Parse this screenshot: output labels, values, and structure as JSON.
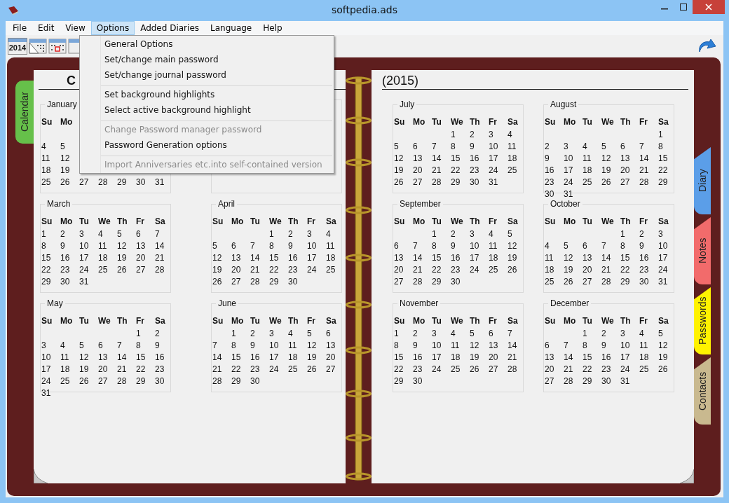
{
  "window": {
    "title": "softpedia.ads"
  },
  "menu": [
    {
      "label": "File",
      "selected": false
    },
    {
      "label": "Edit",
      "selected": false
    },
    {
      "label": "View",
      "selected": false
    },
    {
      "label": "Options",
      "selected": true
    },
    {
      "label": "Added Diaries",
      "selected": false
    },
    {
      "label": "Language",
      "selected": false
    },
    {
      "label": "Help",
      "selected": false
    }
  ],
  "dropdown": {
    "groups": [
      [
        {
          "label": "General Options",
          "disabled": false
        },
        {
          "label": "Set/change main password",
          "disabled": false
        },
        {
          "label": "Set/change journal password",
          "disabled": false
        }
      ],
      [
        {
          "label": "Set background highlights",
          "disabled": false
        },
        {
          "label": "Select active background highlight",
          "disabled": false
        }
      ],
      [
        {
          "label": "Change Password manager password",
          "disabled": true
        },
        {
          "label": "Password Generation options",
          "disabled": false
        }
      ],
      [
        {
          "label": "Import Anniversaries etc.into self-contained version",
          "disabled": true
        }
      ]
    ]
  },
  "toolbar": {
    "year_button": "2014"
  },
  "tabs": [
    {
      "label": "Calendar",
      "selected": true,
      "color": "#66c04a"
    },
    {
      "label": "Diary",
      "selected": false,
      "color": "#5b9ee8"
    },
    {
      "label": "Notes",
      "selected": false,
      "color": "#f26b6b"
    },
    {
      "label": "Passwords",
      "selected": false,
      "color": "#fff200"
    },
    {
      "label": "Contacts",
      "selected": false,
      "color": "#c9b98f"
    }
  ],
  "pages": [
    {
      "heading": "C",
      "months": [
        {
          "kind": "month_first_row_covered",
          "name": "January",
          "day_headers": [
            "Su",
            "Mo"
          ],
          "weeks": [
            [
              "4",
              "5"
            ],
            [
              "11",
              "12"
            ],
            [
              "18",
              "19"
            ],
            [
              "25",
              "26",
              "27",
              "28",
              "29",
              "30",
              "31"
            ]
          ]
        },
        {
          "kind": "covered_frame"
        },
        {
          "kind": "month",
          "name": "March",
          "day_headers": [
            "Su",
            "Mo",
            "Tu",
            "We",
            "Th",
            "Fr",
            "Sa"
          ],
          "weeks": [
            [
              "1",
              "2",
              "3",
              "4",
              "5",
              "6",
              "7"
            ],
            [
              "8",
              "9",
              "10",
              "11",
              "12",
              "13",
              "14"
            ],
            [
              "15",
              "16",
              "17",
              "18",
              "19",
              "20",
              "21"
            ],
            [
              "22",
              "23",
              "24",
              "25",
              "26",
              "27",
              "28"
            ],
            [
              "29",
              "30",
              "31"
            ]
          ]
        },
        {
          "kind": "month",
          "name": "April",
          "day_headers": [
            "Su",
            "Mo",
            "Tu",
            "We",
            "Th",
            "Fr",
            "Sa"
          ],
          "weeks": [
            [
              "1",
              "2",
              "3",
              "4"
            ],
            [
              "5",
              "6",
              "7",
              "8",
              "9",
              "10",
              "11"
            ],
            [
              "12",
              "13",
              "14",
              "15",
              "16",
              "17",
              "18"
            ],
            [
              "19",
              "20",
              "21",
              "22",
              "23",
              "24",
              "25"
            ],
            [
              "26",
              "27",
              "28",
              "29",
              "30"
            ]
          ]
        },
        {
          "kind": "month",
          "name": "May",
          "day_headers": [
            "Su",
            "Mo",
            "Tu",
            "We",
            "Th",
            "Fr",
            "Sa"
          ],
          "weeks": [
            [
              "1",
              "2"
            ],
            [
              "3",
              "4",
              "5",
              "6",
              "7",
              "8",
              "9"
            ],
            [
              "10",
              "11",
              "12",
              "13",
              "14",
              "15",
              "16"
            ],
            [
              "17",
              "18",
              "19",
              "20",
              "21",
              "22",
              "23"
            ],
            [
              "24",
              "25",
              "26",
              "27",
              "28",
              "29",
              "30"
            ],
            [
              "31"
            ]
          ]
        },
        {
          "kind": "month",
          "name": "June",
          "day_headers": [
            "Su",
            "Mo",
            "Tu",
            "We",
            "Th",
            "Fr",
            "Sa"
          ],
          "weeks": [
            [
              "1",
              "2",
              "3",
              "4",
              "5",
              "6"
            ],
            [
              "7",
              "8",
              "9",
              "10",
              "11",
              "12",
              "13"
            ],
            [
              "14",
              "15",
              "16",
              "17",
              "18",
              "19",
              "20"
            ],
            [
              "21",
              "22",
              "23",
              "24",
              "25",
              "26",
              "27"
            ],
            [
              "28",
              "29",
              "30"
            ]
          ]
        }
      ]
    },
    {
      "heading": "(2015)",
      "months": [
        {
          "kind": "month",
          "name": "July",
          "day_headers": [
            "Su",
            "Mo",
            "Tu",
            "We",
            "Th",
            "Fr",
            "Sa"
          ],
          "weeks": [
            [
              "1",
              "2",
              "3",
              "4"
            ],
            [
              "5",
              "6",
              "7",
              "8",
              "9",
              "10",
              "11"
            ],
            [
              "12",
              "13",
              "14",
              "15",
              "16",
              "17",
              "18"
            ],
            [
              "19",
              "20",
              "21",
              "22",
              "23",
              "24",
              "25"
            ],
            [
              "26",
              "27",
              "28",
              "29",
              "30",
              "31"
            ]
          ]
        },
        {
          "kind": "month",
          "name": "August",
          "day_headers": [
            "Su",
            "Mo",
            "Tu",
            "We",
            "Th",
            "Fr",
            "Sa"
          ],
          "weeks": [
            [
              "1"
            ],
            [
              "2",
              "3",
              "4",
              "5",
              "6",
              "7",
              "8"
            ],
            [
              "9",
              "10",
              "11",
              "12",
              "13",
              "14",
              "15"
            ],
            [
              "16",
              "17",
              "18",
              "19",
              "20",
              "21",
              "22"
            ],
            [
              "23",
              "24",
              "25",
              "26",
              "27",
              "28",
              "29"
            ],
            [
              "30",
              "31"
            ]
          ]
        },
        {
          "kind": "month",
          "name": "September",
          "day_headers": [
            "Su",
            "Mo",
            "Tu",
            "We",
            "Th",
            "Fr",
            "Sa"
          ],
          "weeks": [
            [
              "1",
              "2",
              "3",
              "4",
              "5"
            ],
            [
              "6",
              "7",
              "8",
              "9",
              "10",
              "11",
              "12"
            ],
            [
              "13",
              "14",
              "15",
              "16",
              "17",
              "18",
              "19"
            ],
            [
              "20",
              "21",
              "22",
              "23",
              "24",
              "25",
              "26"
            ],
            [
              "27",
              "28",
              "29",
              "30"
            ]
          ]
        },
        {
          "kind": "month",
          "name": "October",
          "day_headers": [
            "Su",
            "Mo",
            "Tu",
            "We",
            "Th",
            "Fr",
            "Sa"
          ],
          "weeks": [
            [
              "1",
              "2",
              "3"
            ],
            [
              "4",
              "5",
              "6",
              "7",
              "8",
              "9",
              "10"
            ],
            [
              "11",
              "12",
              "13",
              "14",
              "15",
              "16",
              "17"
            ],
            [
              "18",
              "19",
              "20",
              "21",
              "22",
              "23",
              "24"
            ],
            [
              "25",
              "26",
              "27",
              "28",
              "29",
              "30",
              "31"
            ]
          ]
        },
        {
          "kind": "month",
          "name": "November",
          "day_headers": [
            "Su",
            "Mo",
            "Tu",
            "We",
            "Th",
            "Fr",
            "Sa"
          ],
          "weeks": [
            [
              "1",
              "2",
              "3",
              "4",
              "5",
              "6",
              "7"
            ],
            [
              "8",
              "9",
              "10",
              "11",
              "12",
              "13",
              "14"
            ],
            [
              "15",
              "16",
              "17",
              "18",
              "19",
              "20",
              "21"
            ],
            [
              "22",
              "23",
              "24",
              "25",
              "26",
              "27",
              "28"
            ],
            [
              "29",
              "30"
            ]
          ]
        },
        {
          "kind": "month",
          "name": "December",
          "day_headers": [
            "Su",
            "Mo",
            "Tu",
            "We",
            "Th",
            "Fr",
            "Sa"
          ],
          "weeks": [
            [
              "1",
              "2",
              "3",
              "4",
              "5"
            ],
            [
              "6",
              "7",
              "8",
              "9",
              "10",
              "11",
              "12"
            ],
            [
              "13",
              "14",
              "15",
              "16",
              "17",
              "18",
              "19"
            ],
            [
              "20",
              "21",
              "22",
              "23",
              "24",
              "25",
              "26"
            ],
            [
              "27",
              "28",
              "29",
              "30",
              "31"
            ]
          ]
        }
      ]
    }
  ]
}
